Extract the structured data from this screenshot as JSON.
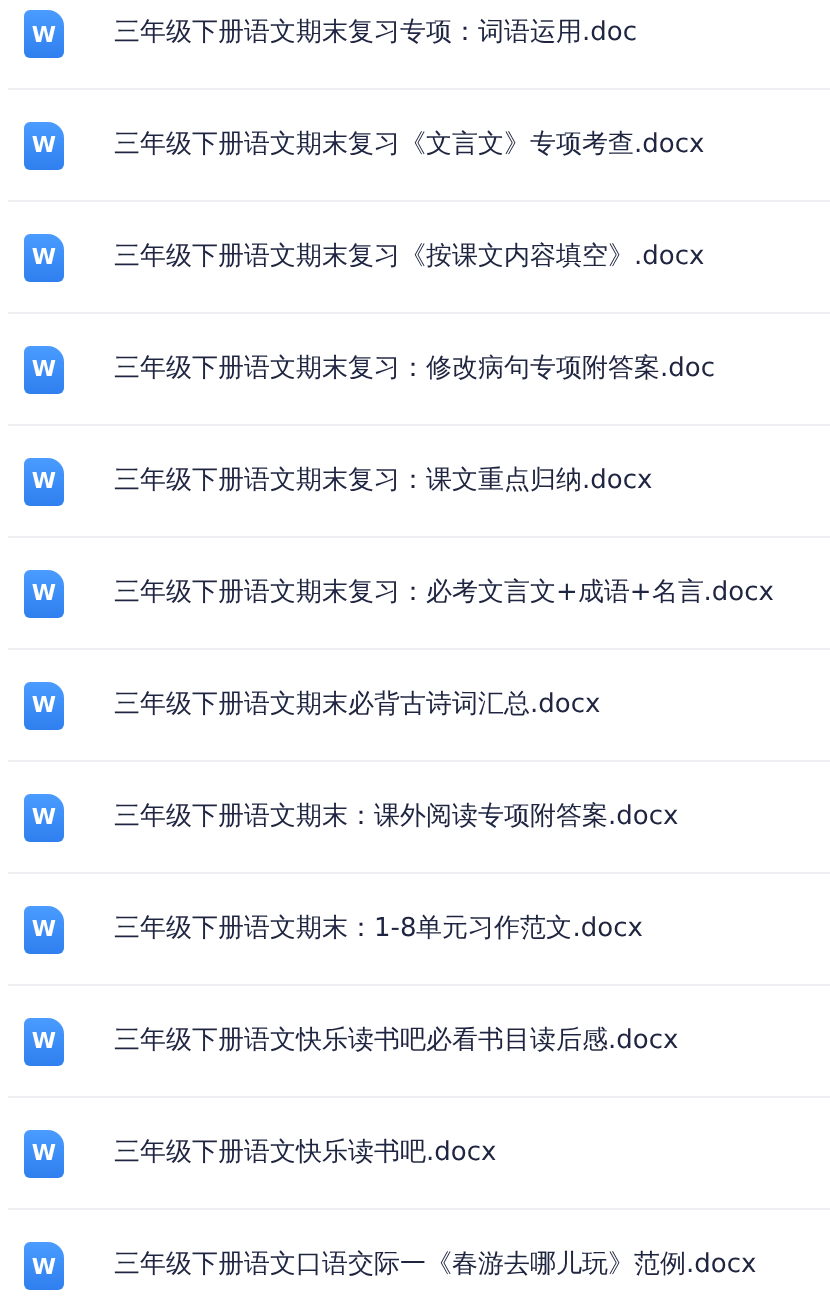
{
  "files": [
    {
      "icon": "W",
      "name": "三年级下册语文期末复习专项：词语运用.doc"
    },
    {
      "icon": "W",
      "name": "三年级下册语文期末复习《文言文》专项考查.docx"
    },
    {
      "icon": "W",
      "name": "三年级下册语文期末复习《按课文内容填空》.docx"
    },
    {
      "icon": "W",
      "name": "三年级下册语文期末复习：修改病句专项附答案.doc"
    },
    {
      "icon": "W",
      "name": "三年级下册语文期末复习：课文重点归纳.docx"
    },
    {
      "icon": "W",
      "name": "三年级下册语文期末复习：必考文言文+成语+名言.docx"
    },
    {
      "icon": "W",
      "name": "三年级下册语文期末必背古诗词汇总.docx"
    },
    {
      "icon": "W",
      "name": "三年级下册语文期末：课外阅读专项附答案.docx"
    },
    {
      "icon": "W",
      "name": "三年级下册语文期末：1-8单元习作范文.docx"
    },
    {
      "icon": "W",
      "name": "三年级下册语文快乐读书吧必看书目读后感.docx"
    },
    {
      "icon": "W",
      "name": "三年级下册语文快乐读书吧.docx"
    },
    {
      "icon": "W",
      "name": "三年级下册语文口语交际一《春游去哪儿玩》范例.docx"
    }
  ]
}
